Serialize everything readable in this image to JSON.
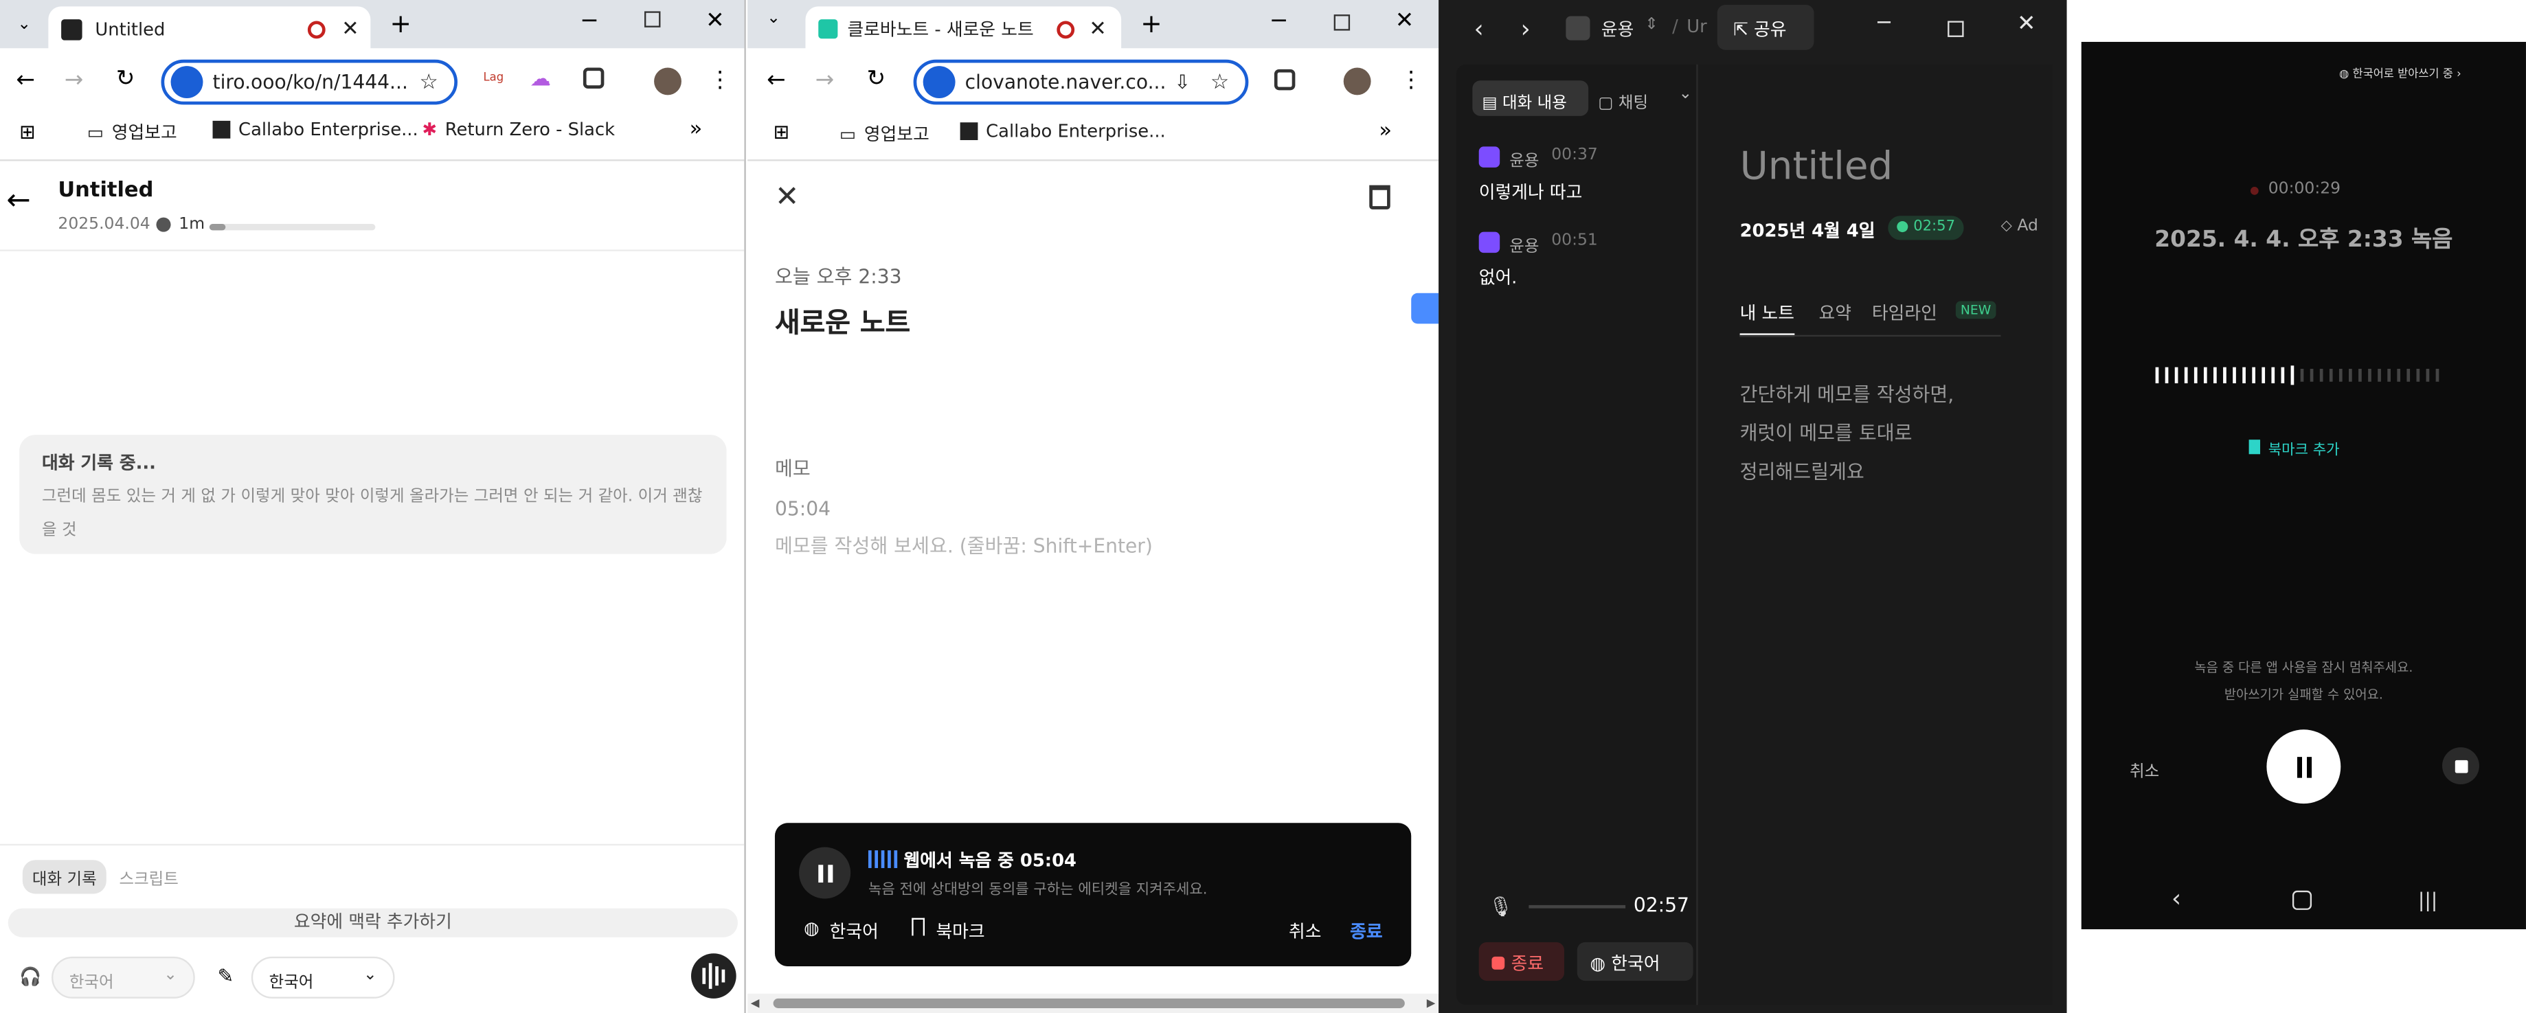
{
  "w1": {
    "tab_title": "Untitled",
    "url": "tiro.ooo/ko/n/1444...",
    "bookmarks": [
      "영업보고",
      "Callabo Enterprise...",
      "Return Zero - Slack"
    ],
    "ext_label": "Lag",
    "note_title": "Untitled",
    "note_date": "2025.04.04",
    "duration": "1m",
    "recording_title": "대화 기록 중...",
    "recording_text": "그런데 몸도 있는 거 게 없 가 이렇게 맞아 맞아 이렇게 올라가는 그러면 안 되는 거 같아. 이거 괜찮을 것",
    "tab_active": "대화 기록",
    "tab_other": "스크립트",
    "add_context": "요약에 맥락 추가하기",
    "lang_left": "한국어",
    "lang_right": "한국어"
  },
  "w2": {
    "tab_title": "클로바노트 - 새로운 노트",
    "url": "clovanote.naver.co...",
    "bookmarks": [
      "영업보고",
      "Callabo Enterprise..."
    ],
    "time_label": "오늘 오후 2:33",
    "note_title": "새로운 노트",
    "memo_label": "메모",
    "memo_time": "05:04",
    "memo_placeholder": "메모를 작성해 보세요. (줄바꿈: Shift+Enter)",
    "rec_title": "웹에서 녹음 중 05:04",
    "rec_sub": "녹음 전에 상대방의 동의를 구하는 에티켓을 지켜주세요.",
    "lang": "한국어",
    "bookmark": "북마크",
    "cancel": "취소",
    "end": "종료"
  },
  "w3": {
    "workspace": "윤용",
    "breadcrumb_tail": "Ur",
    "share": "공유",
    "tab_conv": "대화 내용",
    "tab_chat": "채팅",
    "messages": [
      {
        "speaker": "윤용",
        "time": "00:37",
        "text": "이렇게나 따고"
      },
      {
        "speaker": "윤용",
        "time": "00:51",
        "text": "없어."
      }
    ],
    "player_time": "02:57",
    "end": "종료",
    "lang": "한국어",
    "note_title": "Untitled",
    "note_date": "2025년 4월 4일",
    "badge": "02:57",
    "tag": "Ad",
    "tabs": [
      "내 노트",
      "요약",
      "타임라인"
    ],
    "new_badge": "NEW",
    "memo_lines": [
      "간단하게 메모를 작성하면,",
      "캐럿이 메모를 토대로",
      "정리해드릴게요"
    ]
  },
  "phone": {
    "top_label": "한국어로 받아쓰기 중",
    "timer": "00:00:29",
    "title": "2025. 4. 4. 오후 2:33 녹음",
    "bookmark": "북마크 추가",
    "notice1": "녹음 중 다른 앱 사용을 잠시 멈춰주세요.",
    "notice2": "받아쓰기가 실패할 수 있어요.",
    "cancel": "취소"
  },
  "colors": {
    "chrome_blue": "#1a5fd6",
    "clova_blue": "#4a8cff",
    "badge_green": "#3ecf8e",
    "phone_accent": "#2dd4c8"
  }
}
